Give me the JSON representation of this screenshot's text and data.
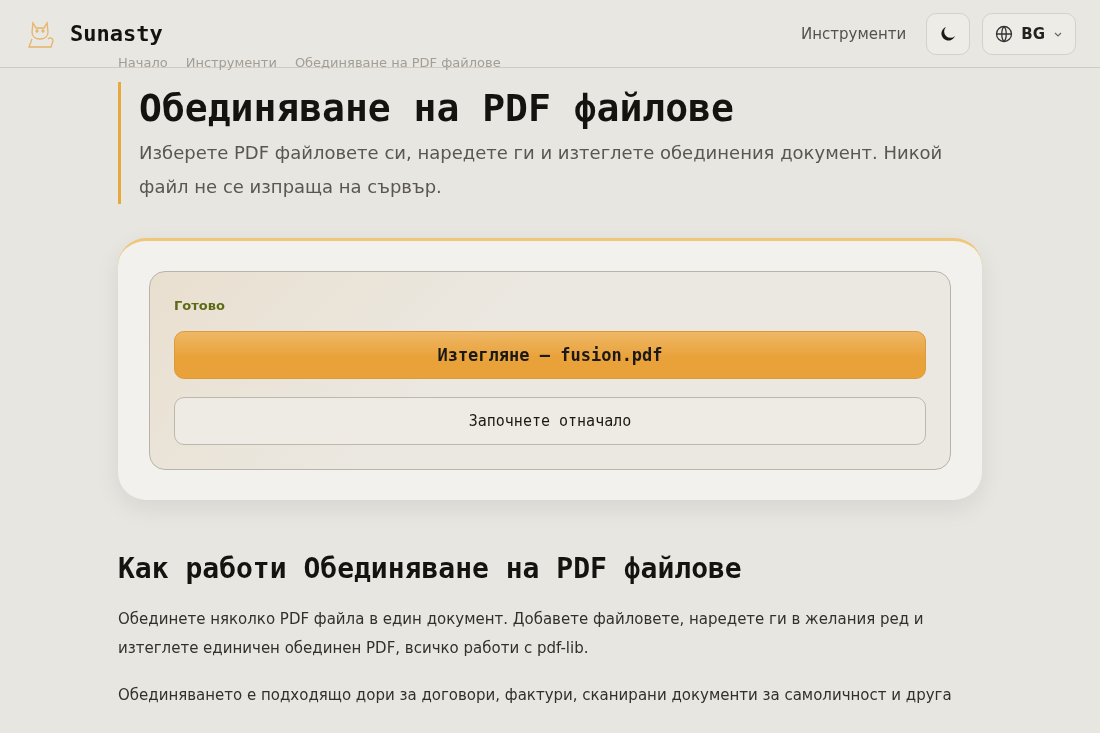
{
  "header": {
    "brand": "Sunasty",
    "nav": [
      {
        "label": "Инструменти"
      }
    ],
    "language": "BG"
  },
  "breadcrumb": [
    "Начало",
    "Инструменти",
    "Обединяване на PDF файлове"
  ],
  "hero": {
    "title": "Обединяване на PDF файлове",
    "subtitle": "Изберете PDF файловете си, наредете ги и изтеглете обединения документ. Никой файл не се изпраща на сървър."
  },
  "result": {
    "status": "Готово",
    "download_button": "Изтегляне — fusion.pdf",
    "restart_button": "Започнете отначало"
  },
  "about": {
    "heading": "Как работи Обединяване на PDF файлове",
    "paragraphs": [
      "Обединете няколко PDF файла в един документ. Добавете файловете, наредете ги в желания ред и изтеглете единичен обединен PDF, всичко работи с pdf-lib.",
      "Обединяването е подходящо дори за договори, фактури, сканирани документи за самоличност и друга"
    ]
  }
}
